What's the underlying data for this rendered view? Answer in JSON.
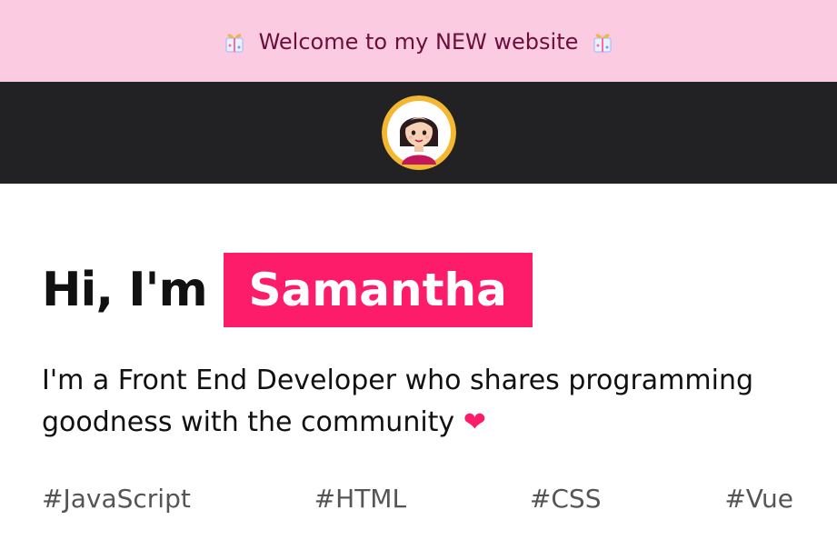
{
  "banner": {
    "text": "Welcome to my NEW website",
    "icon_left": "gift-icon",
    "icon_right": "gift-icon",
    "background": "#fbcce1",
    "text_color": "#6b0f3a"
  },
  "navbar": {
    "background": "#222124",
    "avatar_icon": "avatar-icon"
  },
  "hero": {
    "greeting": "Hi, I'm",
    "name": "Samantha",
    "name_background": "#fd1c6a",
    "intro": "I'm a Front End Developer who shares programming goodness with the community",
    "heart": "❤",
    "heart_color": "#fd1c6a"
  },
  "tags": [
    "#JavaScript",
    "#HTML",
    "#CSS",
    "#Vue"
  ]
}
